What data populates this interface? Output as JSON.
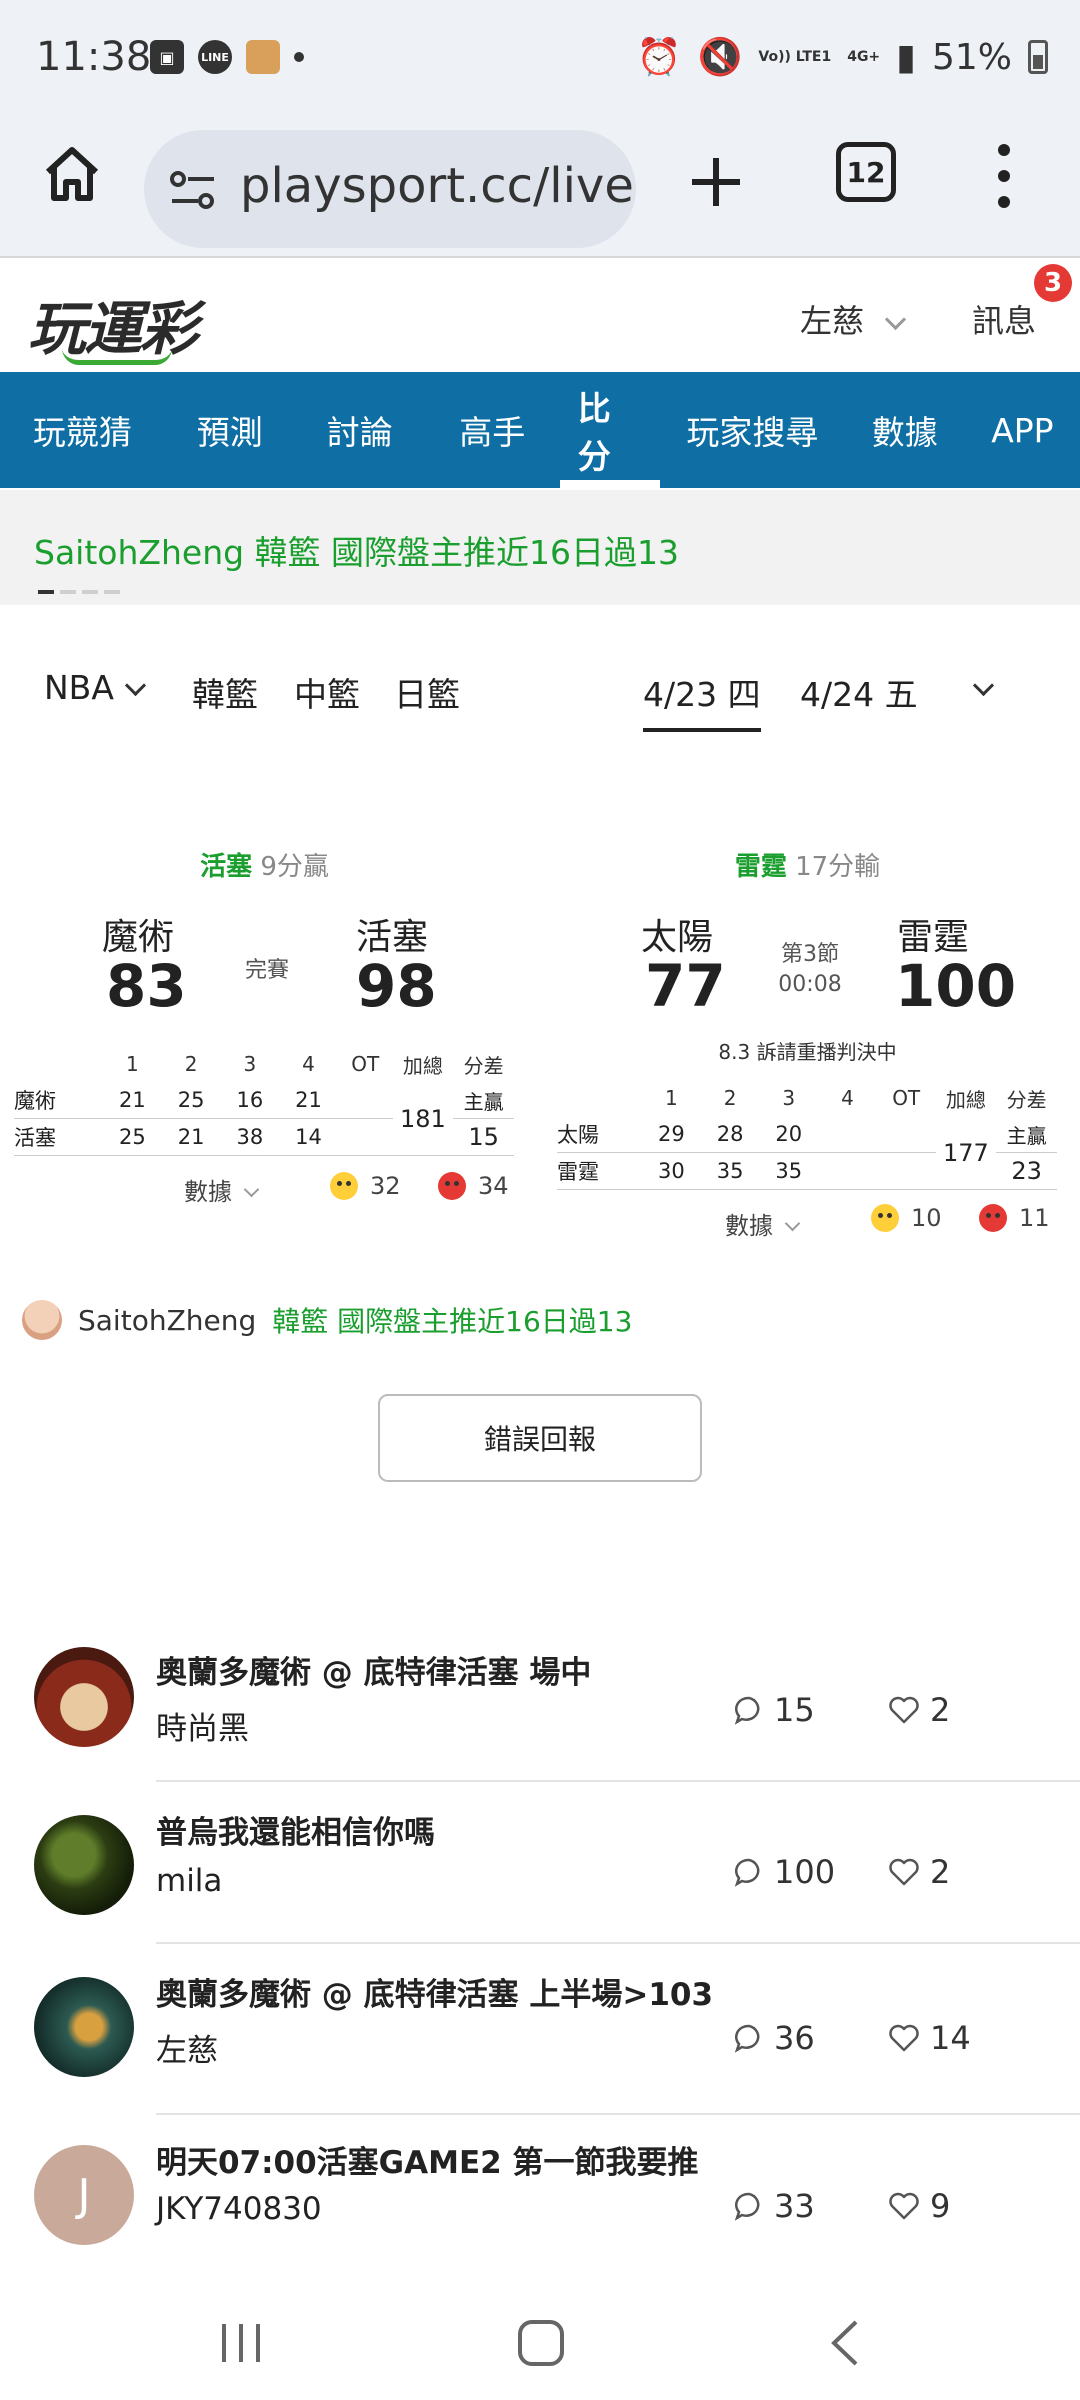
{
  "status_bar": {
    "time": "11:38",
    "line_label": "LINE",
    "volte": "Vo)) LTE1",
    "network": "4G+",
    "battery": "51%"
  },
  "browser": {
    "url": "playsport.cc/lives",
    "tab_count": "12"
  },
  "site": {
    "logo": "玩運彩",
    "user": "左慈",
    "messages_label": "訊息",
    "messages_badge": "3"
  },
  "nav": {
    "items": [
      "玩競猜",
      "預測",
      "討論",
      "高手",
      "比分",
      "玩家搜尋",
      "數據",
      "APP"
    ],
    "active": "比分"
  },
  "ticker": {
    "text": "SaitohZheng 韓籃 國際盤主推近16日過13"
  },
  "filters": {
    "leagues": [
      "NBA",
      "韓籃",
      "中籃",
      "日籃"
    ],
    "dates": [
      "4/23 四",
      "4/24 五"
    ],
    "active_date": "4/23 四"
  },
  "games": [
    {
      "lead_team": "活塞",
      "lead_desc": "9分贏",
      "away": {
        "name": "魔術",
        "score": "83"
      },
      "home": {
        "name": "活塞",
        "score": "98"
      },
      "status": "完賽",
      "status2": "",
      "review_note": "",
      "box_headers": [
        "1",
        "2",
        "3",
        "4",
        "OT",
        "加總",
        "分差"
      ],
      "rows": [
        {
          "team": "魔術",
          "q": [
            "21",
            "25",
            "16",
            "21"
          ],
          "ot": ""
        },
        {
          "team": "活塞",
          "q": [
            "25",
            "21",
            "38",
            "14"
          ],
          "ot": ""
        }
      ],
      "total": "181",
      "spread_label": "主贏",
      "spread": "15",
      "data_label": "數據",
      "money_count": "32",
      "angry_count": "34"
    },
    {
      "lead_team": "雷霆",
      "lead_desc": "17分輸",
      "away": {
        "name": "太陽",
        "score": "77"
      },
      "home": {
        "name": "雷霆",
        "score": "100"
      },
      "status": "第3節",
      "status2": "00:08",
      "review_note": "8.3 訴請重播判決中",
      "box_headers": [
        "1",
        "2",
        "3",
        "4",
        "OT",
        "加總",
        "分差"
      ],
      "rows": [
        {
          "team": "太陽",
          "q": [
            "29",
            "28",
            "20",
            ""
          ],
          "ot": ""
        },
        {
          "team": "雷霆",
          "q": [
            "30",
            "35",
            "35",
            ""
          ],
          "ot": ""
        }
      ],
      "total": "177",
      "spread_label": "主贏",
      "spread": "23",
      "data_label": "數據",
      "money_count": "10",
      "angry_count": "11"
    }
  ],
  "poster": {
    "name": "SaitohZheng",
    "note": "韓籃 國際盤主推近16日過13"
  },
  "report_button": "錯誤回報",
  "discussions": [
    {
      "title": "奧蘭多魔術 @ 底特律活塞 場中",
      "author": "時尚黑",
      "comments": "15",
      "likes": "2"
    },
    {
      "title": "普烏我還能相信你嗎",
      "author": "mila",
      "comments": "100",
      "likes": "2"
    },
    {
      "title": "奧蘭多魔術 @ 底特律活塞 上半場>103",
      "author": "左慈",
      "comments": "36",
      "likes": "14"
    },
    {
      "title": "明天07:00活塞GAME2 第一節我要推",
      "author": "JKY740830",
      "comments": "33",
      "likes": "9",
      "avatar_letter": "J"
    }
  ]
}
